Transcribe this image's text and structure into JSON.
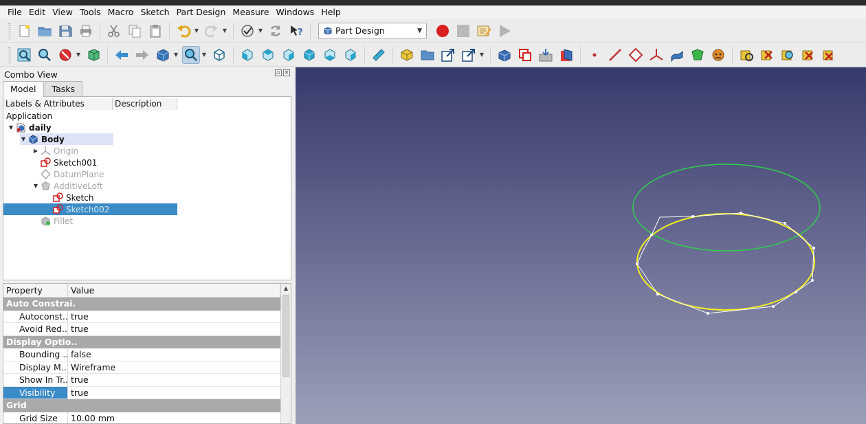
{
  "menubar": {
    "items": [
      "File",
      "Edit",
      "View",
      "Tools",
      "Macro",
      "Sketch",
      "Part Design",
      "Measure",
      "Windows",
      "Help"
    ]
  },
  "toolbar1": {
    "workbench_selected": "Part Design",
    "buttons": [
      "new-document",
      "open-document",
      "save-document",
      "print-document",
      "cut",
      "copy",
      "paste",
      "undo",
      "redo",
      "draw-style",
      "refresh",
      "whats-this",
      "macro-record",
      "macro-stop",
      "macro-edit",
      "macro-execute"
    ]
  },
  "toolbar2": {
    "buttons": [
      "fit-all",
      "fit-selection",
      "draw-style",
      "bounding-box",
      "back",
      "forward",
      "std-views",
      "zoom-box",
      "view-isometric",
      "view-front",
      "view-top",
      "view-right",
      "view-rear",
      "view-bottom",
      "view-left",
      "measure-distance",
      "create-body",
      "create-part",
      "create-link",
      "link-actions",
      "shape-binder",
      "sub-shape-binder",
      "clone",
      "create-datum",
      "datum-point",
      "datum-line",
      "datum-plane",
      "local-cs",
      "additive-pad",
      "additive-loft",
      "pocket",
      "validate-sketch",
      "close-shape",
      "find-errors",
      "sketch-tools"
    ]
  },
  "combo_view": {
    "title": "Combo View",
    "tabs": [
      "Model",
      "Tasks"
    ],
    "tree": {
      "columns": [
        "Labels & Attributes",
        "Description"
      ],
      "root_label": "Application",
      "items": [
        {
          "label": "daily",
          "bold": true
        },
        {
          "label": "Body",
          "bold": true
        },
        {
          "label": "Origin"
        },
        {
          "label": "Sketch001"
        },
        {
          "label": "DatumPlane"
        },
        {
          "label": "AdditiveLoft"
        },
        {
          "label": "Sketch"
        },
        {
          "label": "Sketch002",
          "selected": true
        },
        {
          "label": "Fillet"
        }
      ]
    },
    "properties": {
      "columns": [
        "Property",
        "Value"
      ],
      "groups": {
        "auto_constraints": "Auto Constrai.",
        "display_options": "Display Optio..",
        "grid": "Grid"
      },
      "rows": [
        {
          "name": "Autoconst...",
          "value": "true"
        },
        {
          "name": "Avoid Red...",
          "value": "true"
        },
        {
          "name": "Bounding ...",
          "value": "false"
        },
        {
          "name": "Display M...",
          "value": "Wireframe"
        },
        {
          "name": "Show In Tr...",
          "value": "true"
        },
        {
          "name": "Visibility",
          "value": "true",
          "selected": true
        },
        {
          "name": "Grid Size",
          "value": "10.00 mm"
        }
      ]
    }
  },
  "viewport": {
    "background_top": "#363a6b",
    "background_bottom": "#9c9fb7",
    "upper_circle_color": "#2fd04a",
    "lower_circle_color": "#f2f01e",
    "vertex_color": "#ffffff"
  },
  "colors": {
    "selection": "#3b8bc6",
    "property_group": "#a9a9a9",
    "record_button": "#d82020"
  }
}
